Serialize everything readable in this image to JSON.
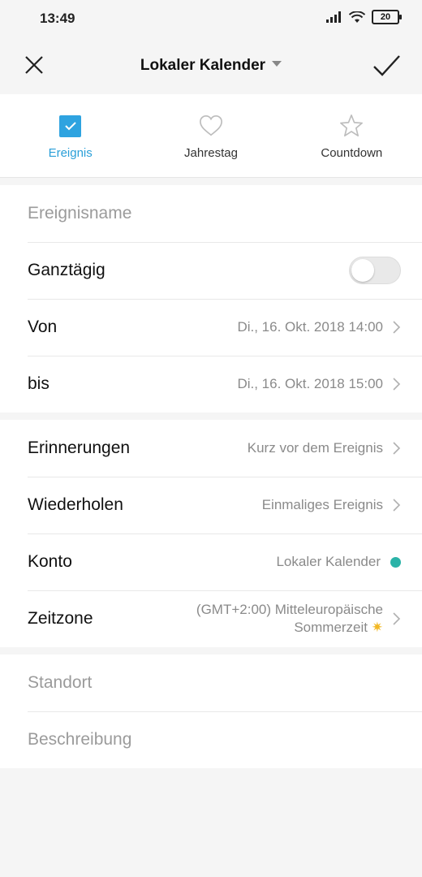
{
  "status_bar": {
    "time": "13:49",
    "battery": "20"
  },
  "header": {
    "title": "Lokaler Kalender"
  },
  "tabs": [
    {
      "label": "Ereignis",
      "icon": "checkbox-icon",
      "active": true
    },
    {
      "label": "Jahrestag",
      "icon": "heart-icon",
      "active": false
    },
    {
      "label": "Countdown",
      "icon": "star-icon",
      "active": false
    }
  ],
  "event": {
    "name_placeholder": "Ereignisname"
  },
  "allday": {
    "label": "Ganztägig",
    "on": false
  },
  "from": {
    "label": "Von",
    "value": "Di., 16. Okt. 2018 14:00"
  },
  "to": {
    "label": "bis",
    "value": "Di., 16. Okt. 2018 15:00"
  },
  "reminders": {
    "label": "Erinnerungen",
    "value": "Kurz vor dem Ereignis"
  },
  "repeat": {
    "label": "Wiederholen",
    "value": "Einmaliges Ereignis"
  },
  "account": {
    "label": "Konto",
    "value": "Lokaler Kalender",
    "color": "#2bb3a8"
  },
  "timezone": {
    "label": "Zeitzone",
    "value_line1": "(GMT+2:00) Mitteleuropäische",
    "value_line2": "Sommerzeit",
    "icon": "sun-icon"
  },
  "location": {
    "placeholder": "Standort"
  },
  "description": {
    "placeholder": "Beschreibung"
  },
  "colors": {
    "accent": "#2ea3e0"
  }
}
